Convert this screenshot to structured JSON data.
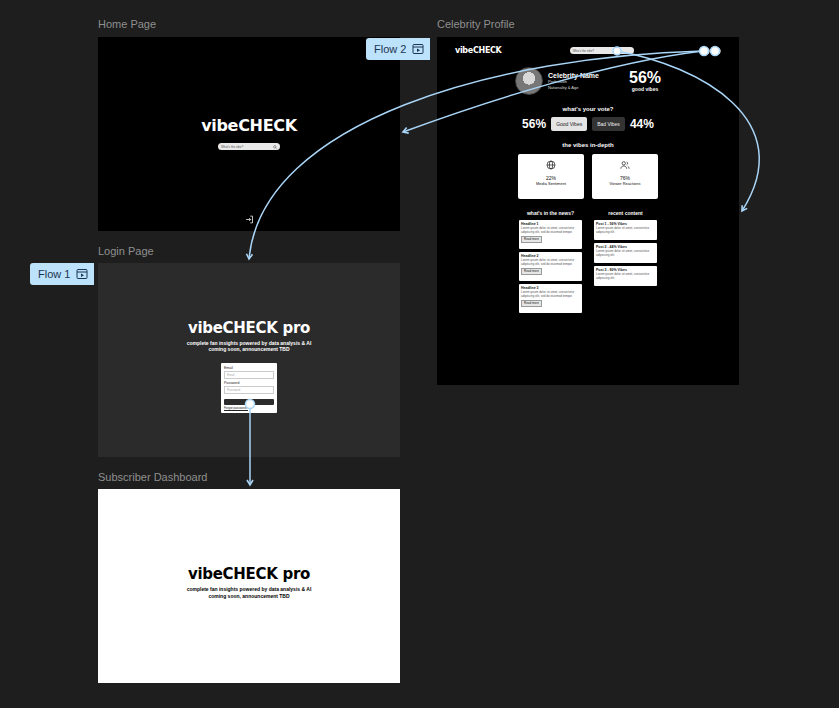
{
  "flows": [
    {
      "label": "Flow 2"
    },
    {
      "label": "Flow 1"
    }
  ],
  "home": {
    "frame_label": "Home Page",
    "logo": "vibeCHECK",
    "search_placeholder": "What's the vibe?"
  },
  "profile": {
    "frame_label": "Celebrity Profile",
    "logo": "vibeCHECK",
    "search_placeholder": "Who's the vibe?",
    "name": "Celebrity Name",
    "details": [
      "Profession",
      "Nationality & Age"
    ],
    "score": "56%",
    "score_label": "good vibes",
    "vote_title": "what's your vote?",
    "votes": [
      {
        "percent": "56%",
        "label": "Good Vibes",
        "kind": "good"
      },
      {
        "percent": "44%",
        "label": "Bad Vibes",
        "kind": "bad"
      }
    ],
    "indepth_title": "the vibes in-depth",
    "metrics": [
      {
        "value": "22%",
        "label": "Media Sentiment",
        "kind": "globe"
      },
      {
        "value": "76%",
        "label": "Viewer Reactions",
        "kind": "users"
      }
    ],
    "news_title": "what's in the news?",
    "news": [
      {
        "headline": "Headline 1",
        "body": "Lorem ipsum dolor sit amet, consectetur adipiscing elit, sed do eiusmod tempor.",
        "button": "Read more"
      },
      {
        "headline": "Headline 2",
        "body": "Lorem ipsum dolor sit amet, consectetur adipiscing elit, sed do eiusmod tempor.",
        "button": "Read more"
      },
      {
        "headline": "Headline 3",
        "body": "Lorem ipsum dolor sit amet, consectetur adipiscing elit, sed do eiusmod tempor.",
        "button": "Read more"
      }
    ],
    "content_title": "recent content",
    "posts": [
      {
        "title": "Post 1 - 56% Vibes",
        "body": "Lorem ipsum dolor sit amet, consectetur adipiscing elit."
      },
      {
        "title": "Post 2 - 44% Vibes",
        "body": "Lorem ipsum dolor sit amet, consectetur adipiscing elit."
      },
      {
        "title": "Post 3 - 90% Vibes",
        "body": "Lorem ipsum dolor sit amet, consectetur adipiscing elit."
      }
    ]
  },
  "login": {
    "frame_label": "Login Page",
    "logo": "vibeCHECK pro",
    "tagline": "complete fan insights powered by data analysis & AI",
    "note": "coming soon, announcement TBD",
    "fields": [
      {
        "label": "Email",
        "placeholder": "Email"
      },
      {
        "label": "Password",
        "placeholder": "Password"
      }
    ],
    "forgot": "Forgot password?"
  },
  "dashboard": {
    "frame_label": "Subscriber Dashboard",
    "logo": "vibeCHECK pro",
    "tagline": "complete fan insights powered by data analysis & AI",
    "note": "coming soon, announcement TBD"
  }
}
